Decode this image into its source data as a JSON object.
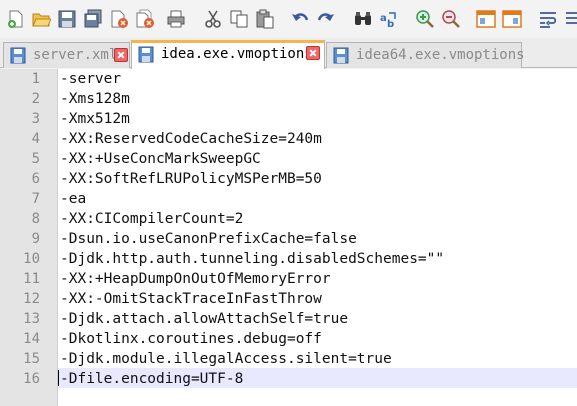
{
  "toolbar": {
    "buttons": [
      {
        "icon": "new-file-icon",
        "color": "#4aa84a"
      },
      {
        "icon": "open-folder-icon",
        "color": "#e3a62a"
      },
      {
        "icon": "save-icon",
        "color": "#5a6e8c"
      },
      {
        "icon": "save-all-icon",
        "color": "#5a6e8c"
      },
      {
        "icon": "close-file-icon",
        "color": "#d94f2b"
      },
      {
        "icon": "close-all-icon",
        "color": "#d94f2b"
      },
      {
        "icon": "print-icon",
        "color": "#6d6d6d"
      },
      {
        "icon": "cut-icon",
        "color": "#5b5b5b"
      },
      {
        "icon": "copy-icon",
        "color": "#5b5b5b"
      },
      {
        "icon": "paste-icon",
        "color": "#5b5b5b"
      },
      {
        "icon": "undo-icon",
        "color": "#3b5998"
      },
      {
        "icon": "redo-icon",
        "color": "#3b5998"
      },
      {
        "icon": "find-icon",
        "color": "#333333"
      },
      {
        "icon": "replace-icon",
        "color": "#2f6db5"
      },
      {
        "icon": "zoom-in-icon",
        "color": "#3c9c3c"
      },
      {
        "icon": "zoom-out-icon",
        "color": "#c94040"
      },
      {
        "icon": "sync-vertical-icon",
        "color": "#e07b1a"
      },
      {
        "icon": "sync-horizontal-icon",
        "color": "#e07b1a"
      },
      {
        "icon": "word-wrap-icon",
        "color": "#3b5998"
      },
      {
        "icon": "show-all-chars-icon",
        "color": "#3b5998"
      }
    ]
  },
  "tabs": [
    {
      "label": "server.xml",
      "active": false
    },
    {
      "label": "idea.exe.vmoptions",
      "active": true
    },
    {
      "label": "idea64.exe.vmoptions",
      "active": false
    }
  ],
  "editor": {
    "current_line": 16,
    "lines": [
      {
        "num": "1",
        "text": "-server"
      },
      {
        "num": "2",
        "text": "-Xms128m"
      },
      {
        "num": "3",
        "text": "-Xmx512m"
      },
      {
        "num": "4",
        "text": "-XX:ReservedCodeCacheSize=240m"
      },
      {
        "num": "5",
        "text": "-XX:+UseConcMarkSweepGC"
      },
      {
        "num": "6",
        "text": "-XX:SoftRefLRUPolicyMSPerMB=50"
      },
      {
        "num": "7",
        "text": "-ea"
      },
      {
        "num": "8",
        "text": "-XX:CICompilerCount=2"
      },
      {
        "num": "9",
        "text": "-Dsun.io.useCanonPrefixCache=false"
      },
      {
        "num": "10",
        "text": "-Djdk.http.auth.tunneling.disabledSchemes=\"\""
      },
      {
        "num": "11",
        "text": "-XX:+HeapDumpOnOutOfMemoryError"
      },
      {
        "num": "12",
        "text": "-XX:-OmitStackTraceInFastThrow"
      },
      {
        "num": "13",
        "text": "-Djdk.attach.allowAttachSelf=true"
      },
      {
        "num": "14",
        "text": "-Dkotlinx.coroutines.debug=off"
      },
      {
        "num": "15",
        "text": "-Djdk.module.illegalAccess.silent=true"
      },
      {
        "num": "16",
        "text": "-Dfile.encoding=UTF-8"
      }
    ]
  },
  "colors": {
    "active_tab_accent": "#f6b44c",
    "current_line_highlight": "#e8e8ff",
    "gutter": "#e4e4e4"
  }
}
